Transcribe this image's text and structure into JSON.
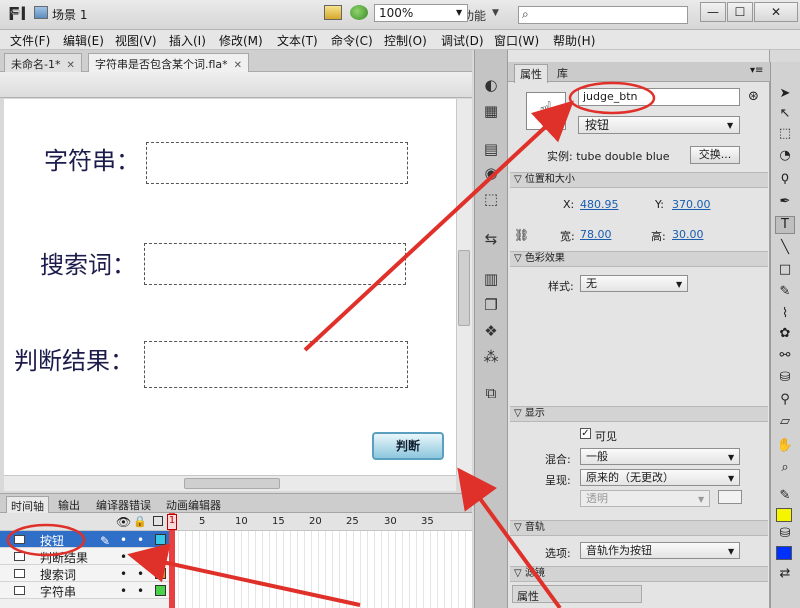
{
  "app": {
    "logo": "Fl",
    "workspace": "基本功能",
    "window_buttons": [
      "—",
      "☐",
      "✕"
    ]
  },
  "menu": [
    "文件(F)",
    "编辑(E)",
    "视图(V)",
    "插入(I)",
    "修改(M)",
    "文本(T)",
    "命令(C)",
    "控制(O)",
    "调试(D)",
    "窗口(W)",
    "帮助(H)"
  ],
  "doc_tabs": [
    {
      "label": "未命名-1*"
    },
    {
      "label": "字符串是否包含某个词.fla*"
    }
  ],
  "editbar": {
    "scene": "场景 1",
    "zoom": "100%"
  },
  "stage": {
    "labels": [
      "字符串：",
      "搜索词：",
      "判断结果："
    ],
    "button_text": "判断"
  },
  "timeline": {
    "tabs": [
      "时间轴",
      "输出",
      "编译器错误",
      "动画编辑器"
    ],
    "frame_numbers": [
      "1",
      "5",
      "10",
      "15",
      "20",
      "25",
      "30",
      "35"
    ],
    "layers": [
      {
        "name": "按钮",
        "color": "#35c8e8",
        "selected": true
      },
      {
        "name": "判断结果",
        "color": "#c04ad0",
        "selected": false
      },
      {
        "name": "搜索词",
        "color": "#f08a1a",
        "selected": false
      },
      {
        "name": "字符串",
        "color": "#4ad04a",
        "selected": false
      }
    ]
  },
  "properties": {
    "tabs": [
      "属性",
      "库"
    ],
    "instance_name": "judge_btn",
    "symbol_type": "按钮",
    "instance_of_label": "实例:",
    "instance_of": "tube double blue",
    "swap_button": "交换...",
    "sections": {
      "position": "位置和大小",
      "color": "色彩效果",
      "display": "显示",
      "track": "音轨",
      "filter": "滤镜"
    },
    "x_label": "X:",
    "x": "480.95",
    "y_label": "Y:",
    "y": "370.00",
    "w_label": "宽:",
    "w": "78.00",
    "h_label": "高:",
    "h": "30.00",
    "style_label": "样式:",
    "style": "无",
    "visible_label": "可见",
    "blend_label": "混合:",
    "blend": "一般",
    "render_label": "呈现:",
    "render": "原来的（无更改）",
    "transparent": "透明",
    "options_label": "选项:",
    "track_option": "音轨作为按钮",
    "bottom_tab": "属性"
  },
  "colors": {
    "annotation": "#e0302a",
    "selection": "#2f6fc8",
    "stroke": "#f5f500",
    "fill": "#0030ff"
  }
}
